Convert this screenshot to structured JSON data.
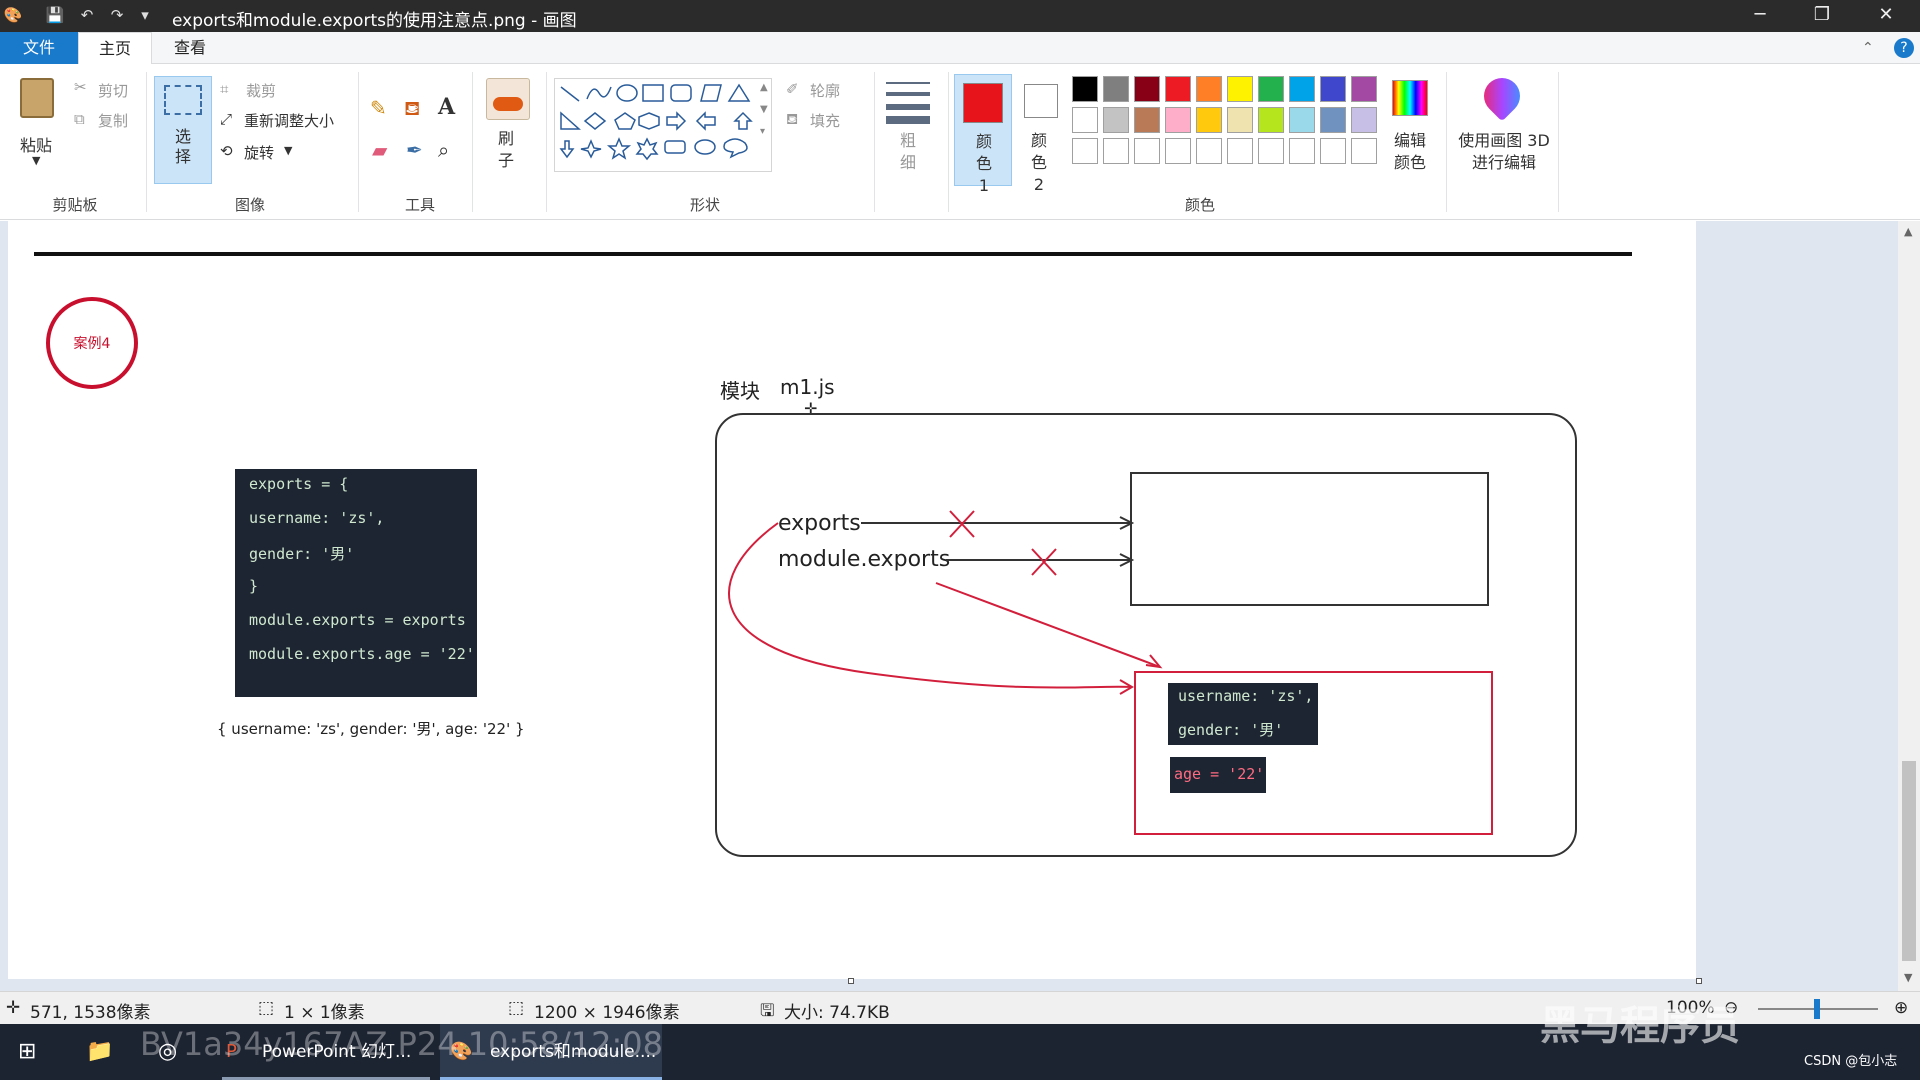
{
  "window": {
    "title": "exports和module.exports的使用注意点.png - 画图",
    "app_icon": "paint-palette-icon",
    "controls": {
      "minimize": "─",
      "restore": "❐",
      "close": "✕"
    }
  },
  "menu_tabs": [
    {
      "label": "文件"
    },
    {
      "label": "主页"
    },
    {
      "label": "查看"
    }
  ],
  "ribbon": {
    "clipboard": {
      "paste": "粘贴",
      "cut": "剪切",
      "copy": "复制",
      "group": "剪贴板"
    },
    "image": {
      "select": "选择",
      "crop": "裁剪",
      "resize": "重新调整大小",
      "rotate": "旋转",
      "group": "图像"
    },
    "tools": {
      "group": "工具",
      "text_tool": "A"
    },
    "brushes": {
      "label": "刷子"
    },
    "shapes": {
      "outline": "轮廓",
      "fill": "填充",
      "group": "形状"
    },
    "size": {
      "label": "粗细"
    },
    "colors": {
      "color1": "颜色 1",
      "color2": "颜色 2",
      "edit": "编辑颜色",
      "paint3d": "使用画图 3D 进行编辑",
      "group": "颜色",
      "color1_value": "#e8141c",
      "color2_value": "#ffffff",
      "palette_row1": [
        "#000000",
        "#7f7f7f",
        "#880015",
        "#ed1c24",
        "#ff7f27",
        "#fff200",
        "#22b14c",
        "#00a2e8",
        "#3f48cc",
        "#a349a4"
      ],
      "palette_row2": [
        "#ffffff",
        "#c3c3c3",
        "#b97a57",
        "#ffaec9",
        "#ffc90e",
        "#efe4b0",
        "#b5e61d",
        "#99d9ea",
        "#7092be",
        "#c8bfe7"
      ]
    }
  },
  "canvas": {
    "badge": "案例4",
    "code_left": {
      "lines": [
        "exports = {",
        "  username: 'zs',",
        "  gender: '男'",
        "}",
        "module.exports = exports",
        "module.exports.age = '22'"
      ]
    },
    "result_text": "{ username: 'zs', gender: '男', age: '22' }",
    "module_label": "模块",
    "module_name": "m1.js",
    "exports_label": "exports",
    "module_exports_label": "module.exports",
    "obj_code_lines": [
      "username: 'zs',",
      "gender: '男'"
    ],
    "obj_age_line": "age = '22'"
  },
  "status": {
    "cursor_pos": "571, 1538像素",
    "selection_size": "1 × 1像素",
    "image_size": "1200 × 1946像素",
    "file_size": "大小: 74.7KB",
    "zoom": "100%"
  },
  "taskbar": {
    "apps": [
      {
        "label": "PowerPoint 幻灯..."
      },
      {
        "label": "exports和module...."
      }
    ],
    "watermark_left": "BV1a34y167AZ P24 10:58/12:08",
    "watermark_right": "黑马程序员",
    "tray_text": "CSDN @包小志"
  }
}
